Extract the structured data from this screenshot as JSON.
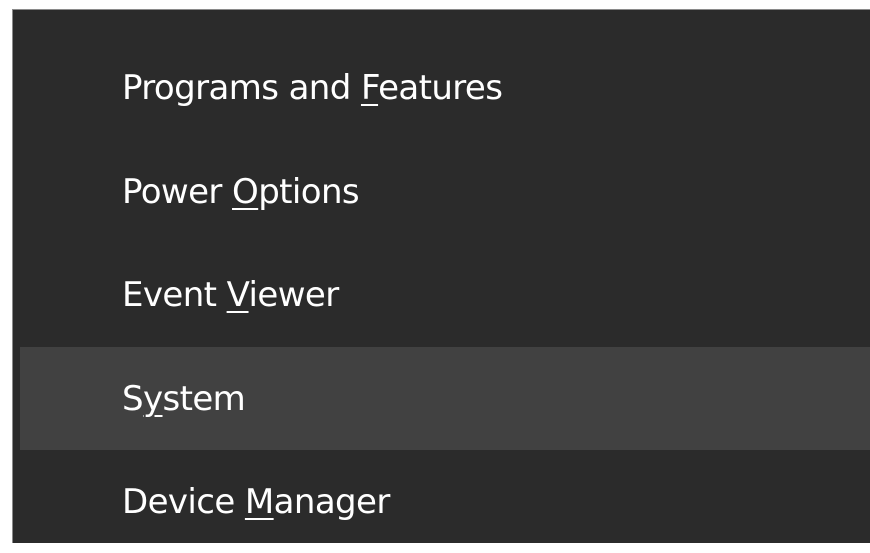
{
  "menu": {
    "items": [
      {
        "before": "Programs and ",
        "accel": "F",
        "after": "eatures",
        "highlighted": false
      },
      {
        "before": "Power ",
        "accel": "O",
        "after": "ptions",
        "highlighted": false
      },
      {
        "before": "Event ",
        "accel": "V",
        "after": "iewer",
        "highlighted": false
      },
      {
        "before": "S",
        "accel": "y",
        "after": "stem",
        "highlighted": true
      },
      {
        "before": "Device ",
        "accel": "M",
        "after": "anager",
        "highlighted": false
      }
    ]
  },
  "colors": {
    "menu_background": "#2b2b2b",
    "hover_background": "#414141",
    "text": "#ffffff"
  }
}
